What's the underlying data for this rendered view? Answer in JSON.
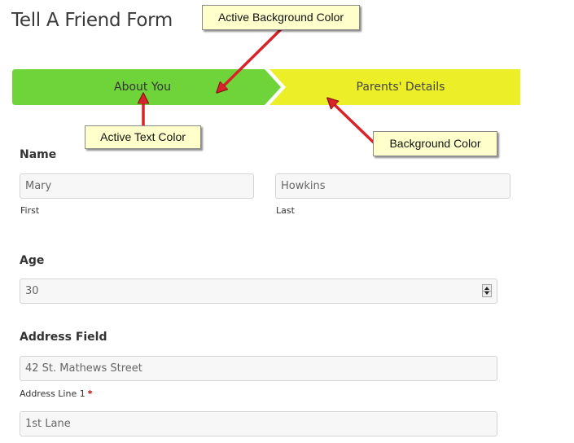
{
  "form": {
    "title": "Tell A Friend Form",
    "steps": [
      {
        "label": "About You",
        "active": true
      },
      {
        "label": "Parents' Details",
        "active": false
      }
    ],
    "colors": {
      "active_bg": "#6fd33a",
      "inactive_bg": "#ecef27",
      "required": "#cc0000"
    },
    "name": {
      "label": "Name",
      "first": {
        "value": "Mary",
        "sub_label": "First"
      },
      "last": {
        "value": "Howkins",
        "sub_label": "Last"
      }
    },
    "age": {
      "label": "Age",
      "value": "30"
    },
    "address": {
      "label": "Address Field",
      "line1": {
        "value": "42 St. Mathews Street",
        "sub_label": "Address Line 1",
        "required_mark": "*"
      },
      "line2": {
        "value": "1st Lane"
      }
    }
  },
  "annotations": {
    "active_background": "Active Background Color",
    "active_text": "Active Text Color",
    "background": "Background Color"
  }
}
